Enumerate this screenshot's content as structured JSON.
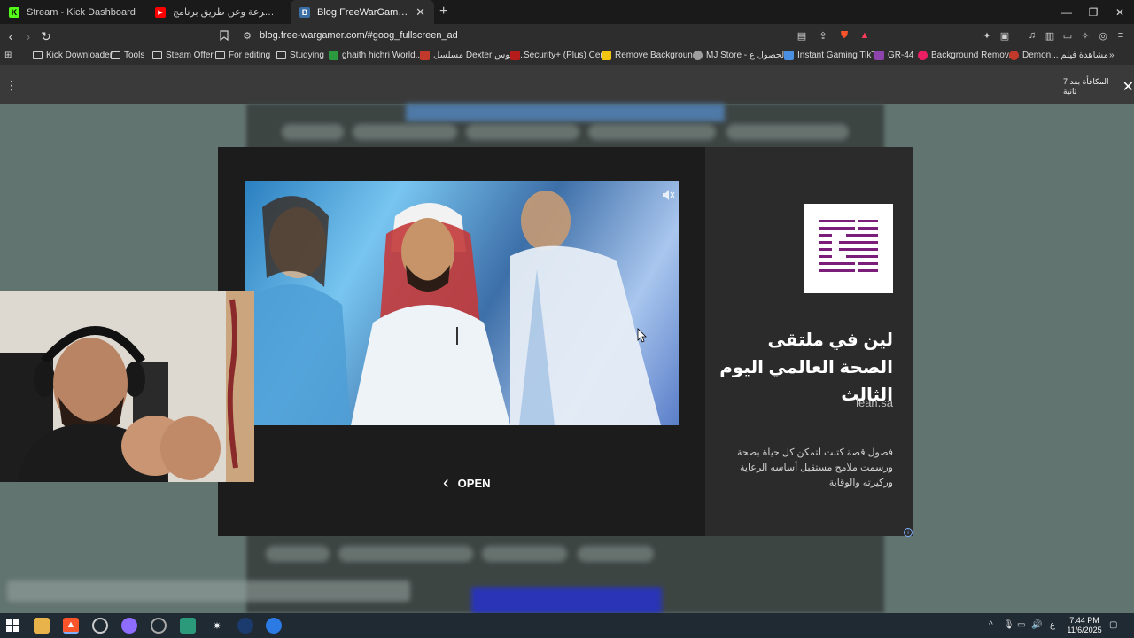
{
  "tabs": [
    {
      "label": "Stream - Kick Dashboard",
      "favicon_color": "#53fc18",
      "favicon_glyph": "K"
    },
    {
      "label": "ترجمة أي لعبة بسرعة وعن طريق برنامج",
      "favicon_color": "#ff0000",
      "favicon_glyph": "▶"
    },
    {
      "label": "Blog FreeWarGamer – Blog Freew",
      "favicon_color": "#3a6ea5",
      "favicon_glyph": "B"
    }
  ],
  "address": {
    "url": "blog.free-wargamer.com/#goog_fullscreen_ad"
  },
  "bookmarks": [
    {
      "label": "Kick Downloader",
      "kind": "folder"
    },
    {
      "label": "Tools",
      "kind": "folder"
    },
    {
      "label": "Steam Offer",
      "kind": "folder"
    },
    {
      "label": "For editing",
      "kind": "folder"
    },
    {
      "label": "Studying",
      "kind": "folder"
    },
    {
      "label": "ghaith hichri World...",
      "kind": "site",
      "color": "#2b9a3f"
    },
    {
      "label": "مسلسل Dexter الموس...",
      "kind": "site",
      "color": "#c0392b"
    },
    {
      "label": "Security+ (Plus) Cer...",
      "kind": "site",
      "color": "#b71c1c"
    },
    {
      "label": "Remove Backgroun...",
      "kind": "site",
      "color": "#f1c40f"
    },
    {
      "label": "MJ Store - الحصول ع...",
      "kind": "site",
      "color": "#9e9e9e"
    },
    {
      "label": "Instant Gaming TikT...",
      "kind": "site",
      "color": "#4a90e2"
    },
    {
      "label": "GR-44",
      "kind": "site",
      "color": "#8e44ad"
    },
    {
      "label": "Background Remov...",
      "kind": "site",
      "color": "#e91e63"
    },
    {
      "label": "Demon... مشاهدة فيلم",
      "kind": "site",
      "color": "#c0392b"
    }
  ],
  "page": {
    "close_ad_text": "المكافأة بعد 7 ثانية"
  },
  "ad": {
    "open_label": "OPEN",
    "title": "لين في ملتقى الصحة العالمي اليوم الثالث",
    "domain": "lean.sa",
    "description": "فصول قصة كتبت لتمكن كل حياة بصحة ورسمت ملامح مستقبل أساسه الرعاية وركيزته والوقاية",
    "info_icon": "info-icon",
    "brand_color": "#7b1e7a"
  },
  "taskbar": {
    "time": "7:44 PM",
    "date": "11/6/2025",
    "lang": "ع"
  }
}
